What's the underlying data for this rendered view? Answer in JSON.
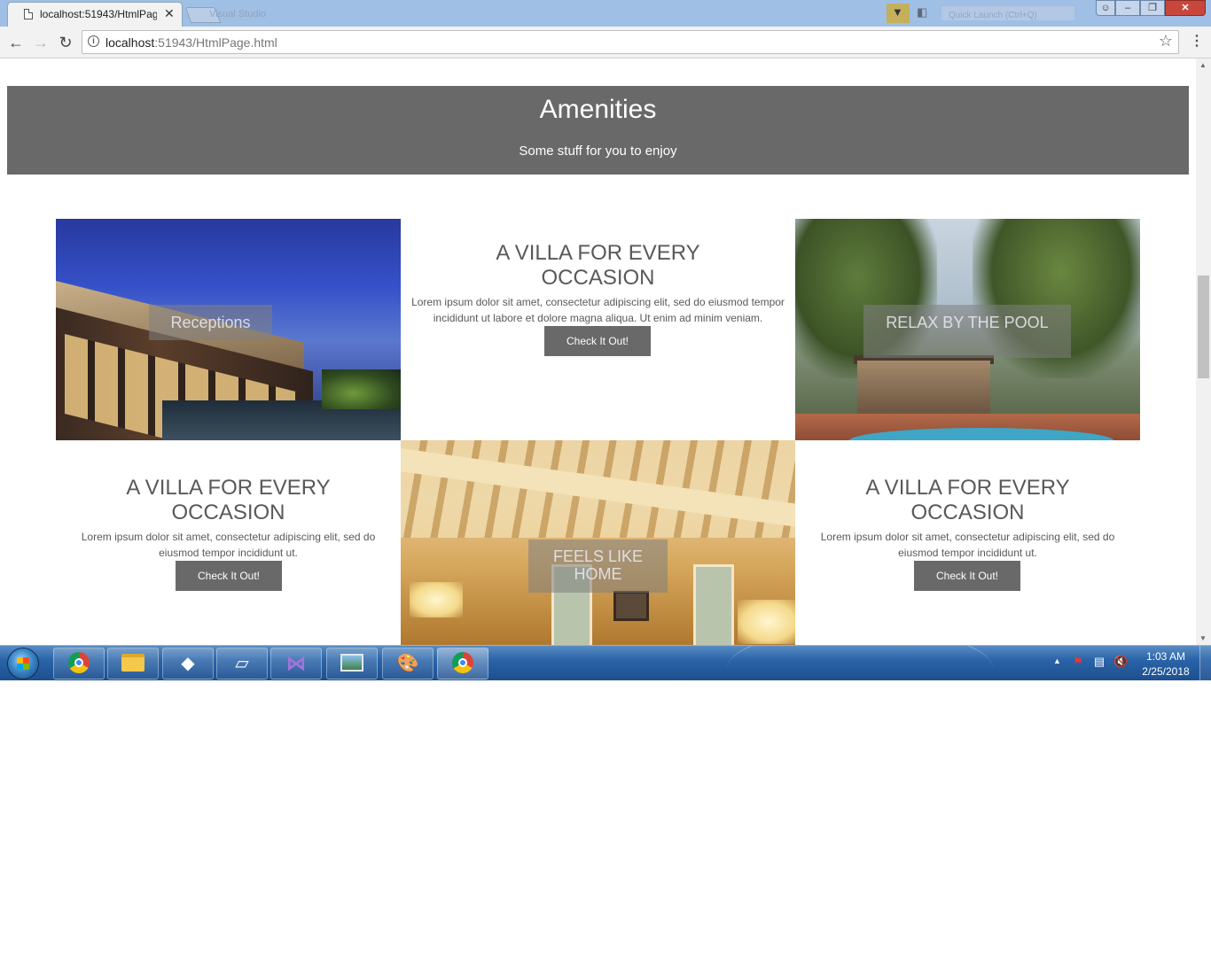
{
  "browser": {
    "tab_title": "localhost:51943/HtmlPage.html",
    "url_host": "localhost",
    "url_rest": ":51943/HtmlPage.html",
    "ghost_tab_label": "Visual Studio",
    "title_search_placeholder": "Quick Launch (Ctrl+Q)",
    "icons": {
      "tab": "document-icon",
      "close": "close-icon",
      "back": "back-arrow-icon",
      "forward": "forward-arrow-icon",
      "reload": "reload-icon",
      "info": "info-icon",
      "bookmark": "star-icon",
      "menu": "kebab-menu-icon"
    }
  },
  "page": {
    "header": {
      "title": "Amenities",
      "subtitle": "Some stuff for you to enjoy"
    },
    "tiles": [
      {
        "label": "Receptions"
      },
      {
        "label": "RELAX BY THE POOL"
      },
      {
        "label": "FEELS LIKE HOME"
      }
    ],
    "cards": [
      {
        "title": "A VILLA FOR EVERY OCCASION",
        "body": "Lorem ipsum dolor sit amet, consectetur adipiscing elit, sed do eiusmod tempor incididunt ut labore et dolore magna aliqua. Ut enim ad minim veniam.",
        "button": "Check It Out!"
      },
      {
        "title": "A VILLA FOR EVERY OCCASION",
        "body": "Lorem ipsum dolor sit amet, consectetur adipiscing elit, sed do eiusmod tempor incididunt ut.",
        "button": "Check It Out!"
      },
      {
        "title": "A VILLA FOR EVERY OCCASION",
        "body": "Lorem ipsum dolor sit amet, consectetur adipiscing elit, sed do eiusmod tempor incididunt ut.",
        "button": "Check It Out!"
      }
    ],
    "colors": {
      "banner": "#696969",
      "button": "#696969",
      "heading_text": "#595959"
    }
  },
  "taskbar": {
    "apps": [
      "chrome-icon",
      "file-explorer-icon",
      "app-icon",
      "notes-icon",
      "visual-studio-icon",
      "photo-viewer-icon",
      "paint-icon",
      "chrome-icon"
    ],
    "time": "1:03 AM",
    "date": "2/25/2018"
  }
}
